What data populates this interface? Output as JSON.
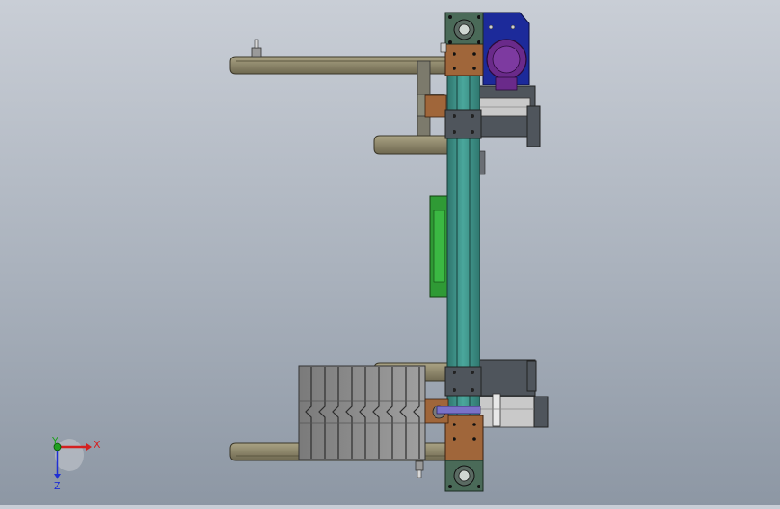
{
  "viewport": {
    "background_top": "#c9ced6",
    "background_bottom": "#8d97a4"
  },
  "colors": {
    "rail_olive": "#8a8468",
    "rail_dark": "#4a4636",
    "beam_teal": "#3f8f86",
    "plate_brown": "#a0663a",
    "motor_blue": "#1c2a9a",
    "motor_purple": "#6a2a8a",
    "green_board": "#2f9a35",
    "steel_grey": "#4f555c",
    "stack_grey": "#8c8c8c"
  },
  "triad": {
    "x_label": "X",
    "y_label": "Y",
    "z_label": "Z",
    "x_color": "#d42020",
    "y_color": "#1fa01f",
    "z_color": "#1f2fd4"
  }
}
